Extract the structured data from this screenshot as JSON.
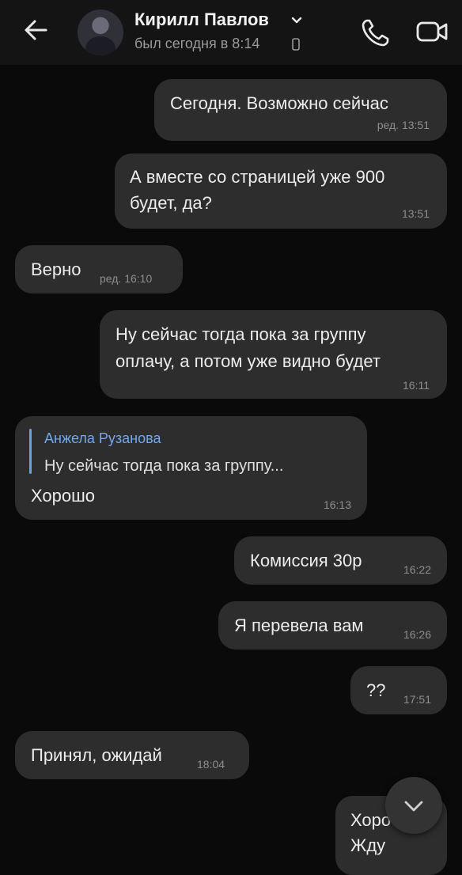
{
  "header": {
    "name": "Кирилл Павлов",
    "status": "был сегодня в 8:14",
    "icons": {
      "back": "arrow-left-icon",
      "dropdown": "chevron-down-icon",
      "device": "phone-device-icon",
      "call": "phone-call-icon",
      "video": "video-camera-icon"
    }
  },
  "messages": [
    {
      "side": "out",
      "text": "Сегодня. Возможно сейчас",
      "time": "ред. 13:51"
    },
    {
      "side": "out",
      "line1": "А вместе со страницей уже 900",
      "line2": "будет, да?",
      "time": "13:51"
    },
    {
      "side": "in",
      "text": "Верно",
      "time": "ред. 16:10"
    },
    {
      "side": "out",
      "line1": "Ну сейчас тогда пока за группу",
      "line2": "оплачу, а потом уже видно будет",
      "time": "16:11"
    },
    {
      "side": "in",
      "reply_author": "Анжела Рузанова",
      "reply_text": "Ну сейчас тогда пока за группу...",
      "text": "Хорошо",
      "time": "16:13"
    },
    {
      "side": "out",
      "text": "Комиссия 30р",
      "time": "16:22"
    },
    {
      "side": "out",
      "text": "Я перевела вам",
      "time": "16:26"
    },
    {
      "side": "out",
      "text": "??",
      "time": "17:51"
    },
    {
      "side": "in",
      "text": "Принял, ожидай",
      "time": "18:04"
    },
    {
      "side": "out",
      "line1": "Хоро",
      "line2": "Жду"
    }
  ],
  "scroll_button_icon": "chevron-down-icon",
  "colors": {
    "background": "#0a0a0a",
    "bubble": "#2d2d2d",
    "accent": "#71a8ee"
  }
}
